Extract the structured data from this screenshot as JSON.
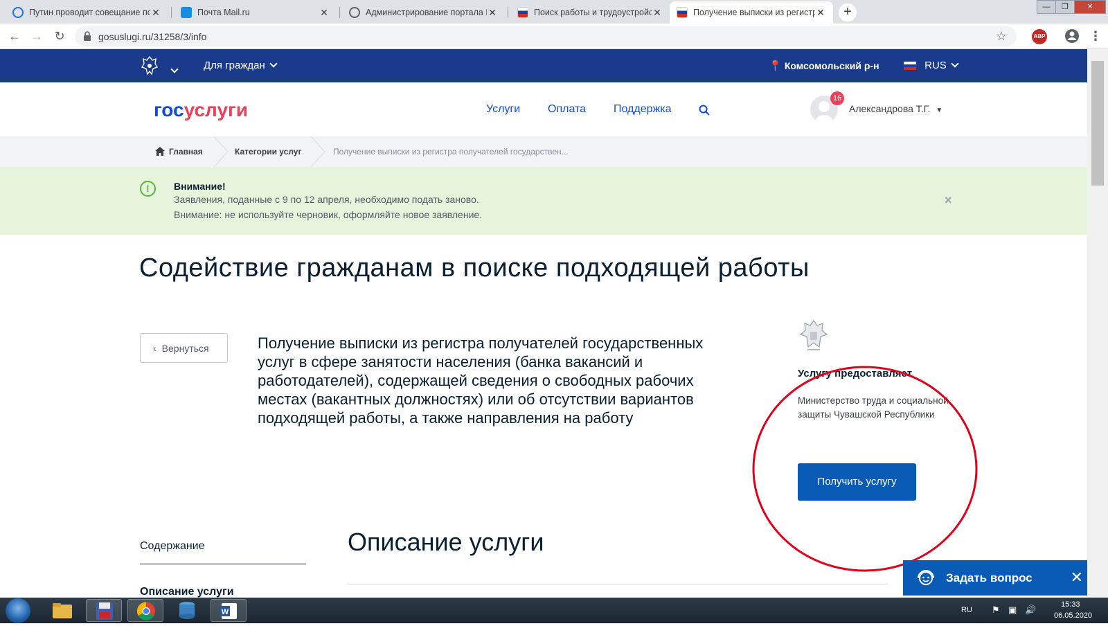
{
  "browser": {
    "tabs": [
      {
        "title": "Путин проводит совещание по",
        "favicon_color": "#1a73e8"
      },
      {
        "title": "Почта Mail.ru",
        "favicon_color": "#168de2"
      },
      {
        "title": "Администрирование портала Р",
        "favicon_color": "#5f6368"
      },
      {
        "title": "Поиск работы и трудоустройств",
        "favicon_color": "#d52b1e"
      },
      {
        "title": "Получение выписки из регистр",
        "favicon_color": "#d52b1e"
      }
    ],
    "new_tab": "+",
    "url": "gosuslugi.ru/31258/3/info",
    "window_controls": [
      "—",
      "❐",
      "✕"
    ]
  },
  "topbar": {
    "citizen_menu": "Для граждан",
    "location": "Комсомольский р-н",
    "language": "RUS"
  },
  "header": {
    "logo_part1": "гос",
    "logo_part2": "услуги",
    "nav": [
      "Услуги",
      "Оплата",
      "Поддержка"
    ],
    "notifications": "16",
    "user": "Александрова Т.Г."
  },
  "breadcrumbs": [
    "Главная",
    "Категории услуг",
    "Получение выписки из регистра получателей государствен..."
  ],
  "alert": {
    "title": "Внимание!",
    "line1": "Заявления, поданные с 9 по 12 апреля, необходимо подать заново.",
    "line2": "Внимание: не используйте черновик, оформляйте новое заявление.",
    "close": "×"
  },
  "page": {
    "title": "Содействие гражданам в поиске подходящей работы",
    "back": "Вернуться",
    "service": "Получение выписки из регистра получателей государственных услуг в сфере занятости населения (банка вакансий и работодателей), содержащей сведения о свободных рабочих местах (вакантных должностях) или об отсутствии вариантов подходящей работы, а также направления на работу",
    "provider_label": "Услугу предоставляет",
    "provider_name": "Министерство труда и социальной защиты Чувашской Республики",
    "get_service": "Получить услугу",
    "toc_title": "Содержание",
    "toc_item": "Описание услуги",
    "section_title": "Описание услуги",
    "ask": "Задать вопрос",
    "ask_close": "✕"
  },
  "tray": {
    "lang": "RU",
    "time": "15:33",
    "date": "06.05.2020"
  },
  "colors": {
    "brand_blue": "#0d4cd3",
    "brand_red": "#ee3f58",
    "topbar": "#1a3b8c",
    "alert_bg": "#e6f4dc",
    "annotation_red": "#e0001b"
  }
}
